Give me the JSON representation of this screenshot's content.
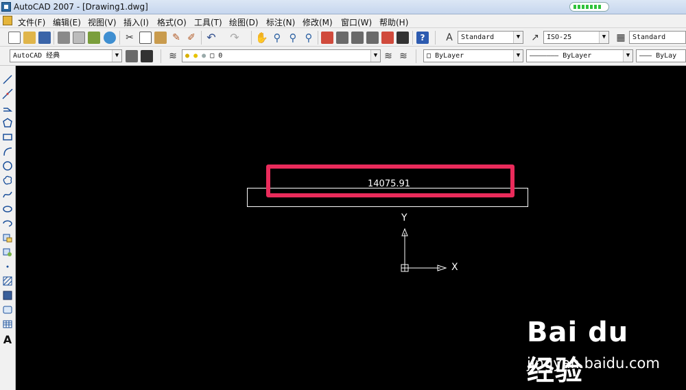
{
  "window": {
    "title": "AutoCAD 2007 - [Drawing1.dwg]",
    "progress_pct": 88
  },
  "menu": {
    "items": [
      "文件(F)",
      "编辑(E)",
      "视图(V)",
      "插入(I)",
      "格式(O)",
      "工具(T)",
      "绘图(D)",
      "标注(N)",
      "修改(M)",
      "窗口(W)",
      "帮助(H)"
    ]
  },
  "toolbar": {
    "text_style": "Standard",
    "dim_style": "ISO-25",
    "table_style": "Standard",
    "workspace": "AutoCAD 经典",
    "layer": "0",
    "color": "ByLayer",
    "linetype": "ByLayer",
    "lineweight": "ByLay"
  },
  "drawing": {
    "value_text": "14075.91",
    "ucs_y": "Y",
    "ucs_x": "X",
    "highlight_color": "#ea2b5b"
  },
  "watermark": {
    "logo": "Bai du 经验",
    "url": "jingyan.baidu.com"
  }
}
